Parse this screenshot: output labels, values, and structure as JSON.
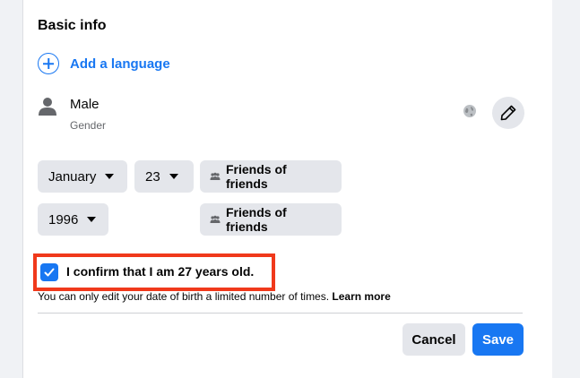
{
  "basic_info": {
    "title": "Basic info",
    "add_language_label": "Add a language"
  },
  "gender": {
    "value": "Male",
    "label": "Gender"
  },
  "birthday": {
    "month": "January",
    "day": "23",
    "year": "1996",
    "date_audience": "Friends of friends",
    "year_audience": "Friends of friends"
  },
  "confirm": {
    "checked": true,
    "text": "I confirm that I am 27 years old.",
    "note_text": "You can only edit your date of birth a limited number of times.",
    "learn_more": "Learn more"
  },
  "actions": {
    "cancel_label": "Cancel",
    "save_label": "Save"
  },
  "colors": {
    "accent": "#1877f2",
    "highlight_border": "#f0391b"
  }
}
